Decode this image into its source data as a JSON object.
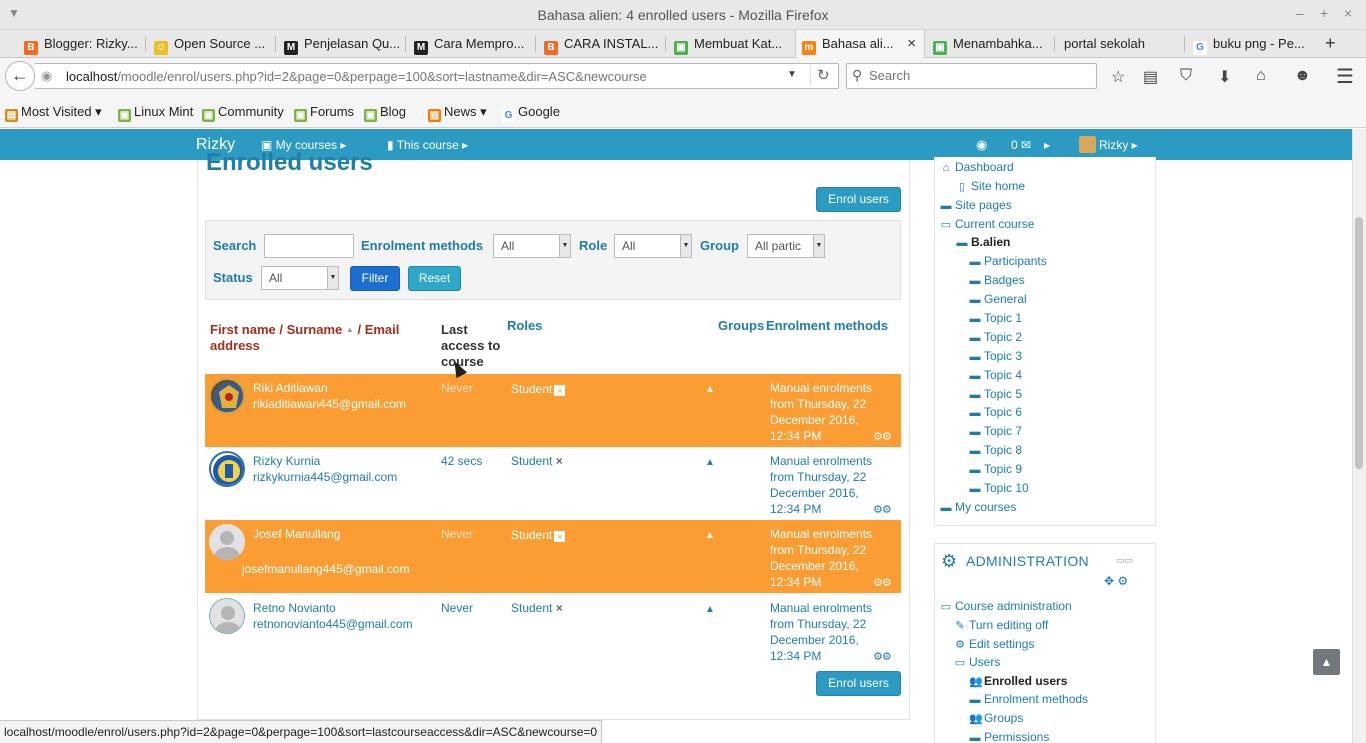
{
  "window": {
    "title": "Bahasa alien: 4 enrolled users - Mozilla Firefox",
    "menu_glyph": "▼",
    "minimize": "–",
    "maximize": "+",
    "close": "×"
  },
  "tabs": [
    {
      "label": "Blogger: Rizky...",
      "icon_color": "#f26b21",
      "icon_glyph": "B",
      "active": false
    },
    {
      "label": "Open Source ...",
      "icon_color": "#e7c02a",
      "icon_glyph": "☺",
      "active": false
    },
    {
      "label": "Penjelasan Qu...",
      "icon_color": "#222222",
      "icon_glyph": "M",
      "active": false
    },
    {
      "label": "Cara Mempro...",
      "icon_color": "#222222",
      "icon_glyph": "M",
      "active": false
    },
    {
      "label": "CARA INSTAL...",
      "icon_color": "#f26b21",
      "icon_glyph": "B",
      "active": false
    },
    {
      "label": "Membuat Kat...",
      "icon_color": "#4caf50",
      "icon_glyph": "▣",
      "active": false
    },
    {
      "label": "Bahasa ali...",
      "icon_color": "#f98012",
      "icon_glyph": "m",
      "active": true
    },
    {
      "label": "Menambahka...",
      "icon_color": "#4caf50",
      "icon_glyph": "▣",
      "active": false
    },
    {
      "label": "portal sekolah",
      "icon_color": "",
      "icon_glyph": "",
      "active": false
    },
    {
      "label": "buku png - Pe...",
      "icon_color": "#4285f4",
      "icon_glyph": "G",
      "active": false
    }
  ],
  "tab_close": "×",
  "newtab": "+",
  "nav": {
    "back": "←",
    "info": "◉",
    "url_host": "localhost",
    "url_path": "/moodle/enrol/users.php?id=2&page=0&perpage=100&sort=lastname&dir=ASC&newcourse",
    "url_drop": "▼",
    "reload": "↻",
    "search_placeholder": "Search",
    "search_icon": "🔍",
    "icons": [
      "☆",
      "▤",
      "⛉",
      "⬇",
      "⌂",
      "☻",
      "☰"
    ]
  },
  "bookmarks": [
    {
      "label": "Most Visited ▾",
      "icon": "▤",
      "color": "#d38c1c"
    },
    {
      "label": "Linux Mint",
      "icon": "▣",
      "color": "#7cb342"
    },
    {
      "label": "Community",
      "icon": "▣",
      "color": "#7cb342"
    },
    {
      "label": "Forums",
      "icon": "▣",
      "color": "#7cb342"
    },
    {
      "label": "Blog",
      "icon": "▣",
      "color": "#7cb342"
    },
    {
      "label": "News ▾",
      "icon": "▥",
      "color": "#f57c00"
    },
    {
      "label": "Google",
      "icon": "G",
      "color": "#4285f4"
    }
  ],
  "moodle_nav": {
    "brand": "Rizky",
    "my_courses": "▣ My courses ▸",
    "this_course": "▮ This course ▸",
    "info_icon": "◉",
    "messages": "0 ✉",
    "messages_arrow": "▸",
    "user": "Rizky ▸"
  },
  "page": {
    "title": "Enrolled users",
    "enrol_button": "Enrol users",
    "enrol_button_bottom": "Enrol users"
  },
  "filters": {
    "search_label": "Search",
    "search_value": "",
    "enrolment_methods_label": "Enrolment methods",
    "enrolment_methods_value": "All",
    "role_label": "Role",
    "role_value": "All",
    "group_label": "Group",
    "group_value": "All partic",
    "status_label": "Status",
    "status_value": "All",
    "filter_button": "Filter",
    "reset_button": "Reset",
    "arrow": "▼"
  },
  "table": {
    "headers": {
      "first_name": "First name",
      "sep1": "/",
      "surname": "Surname",
      "sort_arrow": "▲",
      "sep2": "/",
      "email_line1": "Email",
      "email_line2": "address",
      "last_access_1": "Last",
      "last_access_2": "access to",
      "last_access_3": "course",
      "roles": "Roles",
      "groups": "Groups",
      "enrolment_methods": "Enrolment methods"
    },
    "rows": [
      {
        "name": "Riki Aditiawan",
        "email": "rikiaditiawan445@gmail.com",
        "last_access": "Never",
        "role": "Student",
        "enrol_1": "Manual enrolments",
        "enrol_2": "from Thursday, 22",
        "enrol_3": "December 2016,",
        "enrol_4": "12:34 PM",
        "highlighted": true,
        "avatar": "emblem1"
      },
      {
        "name": "Rizky Kurnia",
        "email": "rizkykurnia445@gmail.com",
        "last_access": "42 secs",
        "role": "Student",
        "enrol_1": "Manual enrolments",
        "enrol_2": "from Thursday, 22",
        "enrol_3": "December 2016,",
        "enrol_4": "12:34 PM",
        "highlighted": false,
        "avatar": "emblem2"
      },
      {
        "name": "Josef Manullang",
        "email": "josefmanullang445@gmail.com",
        "last_access": "Never",
        "role": "Student",
        "enrol_1": "Manual enrolments",
        "enrol_2": "from Thursday, 22",
        "enrol_3": "December 2016,",
        "enrol_4": "12:34 PM",
        "highlighted": true,
        "avatar": "default"
      },
      {
        "name": "Retno Novianto",
        "email": "retnonovianto445@gmail.com",
        "last_access": "Never",
        "role": "Student",
        "enrol_1": "Manual enrolments",
        "enrol_2": "from Thursday, 22",
        "enrol_3": "December 2016,",
        "enrol_4": "12:34 PM",
        "highlighted": false,
        "avatar": "default"
      }
    ],
    "remove_glyph": "×",
    "lock_glyph": "🔒",
    "gears_glyph": "⚙⚙"
  },
  "navigation_block": {
    "items": [
      {
        "label": "Dashboard",
        "icon": "⌂",
        "bold": false
      },
      {
        "label": "Site home",
        "icon": "▯",
        "bold": false
      },
      {
        "label": "Site pages",
        "icon": "▬",
        "bold": false
      },
      {
        "label": "Current course",
        "icon": "▭",
        "bold": false
      },
      {
        "label": "B.alien",
        "icon": "▬",
        "bold": true
      },
      {
        "label": "Participants",
        "icon": "▬",
        "bold": false
      },
      {
        "label": "Badges",
        "icon": "▬",
        "bold": false
      },
      {
        "label": "General",
        "icon": "▬",
        "bold": false
      },
      {
        "label": "Topic 1",
        "icon": "▬",
        "bold": false
      },
      {
        "label": "Topic 2",
        "icon": "▬",
        "bold": false
      },
      {
        "label": "Topic 3",
        "icon": "▬",
        "bold": false
      },
      {
        "label": "Topic 4",
        "icon": "▬",
        "bold": false
      },
      {
        "label": "Topic 5",
        "icon": "▬",
        "bold": false
      },
      {
        "label": "Topic 6",
        "icon": "▬",
        "bold": false
      },
      {
        "label": "Topic 7",
        "icon": "▬",
        "bold": false
      },
      {
        "label": "Topic 8",
        "icon": "▬",
        "bold": false
      },
      {
        "label": "Topic 9",
        "icon": "▬",
        "bold": false
      },
      {
        "label": "Topic 10",
        "icon": "▬",
        "bold": false
      },
      {
        "label": "My courses",
        "icon": "▬",
        "bold": false
      }
    ]
  },
  "admin_block": {
    "title": "ADMINISTRATION",
    "icon": "⚙",
    "ctrl": "▭▭",
    "move": "✥ ⚙",
    "items": [
      {
        "label": "Course administration",
        "icon": "▭",
        "bold": false
      },
      {
        "label": "Turn editing off",
        "icon": "✎",
        "bold": false
      },
      {
        "label": "Edit settings",
        "icon": "⚙",
        "bold": false
      },
      {
        "label": "Users",
        "icon": "▭",
        "bold": false
      },
      {
        "label": "Enrolled users",
        "icon": "👥",
        "bold": true
      },
      {
        "label": "Enrolment methods",
        "icon": "▬",
        "bold": false
      },
      {
        "label": "Groups",
        "icon": "👥",
        "bold": false
      },
      {
        "label": "Permissions",
        "icon": "▬",
        "bold": false
      }
    ]
  },
  "status_url": "localhost/moodle/enrol/users.php?id=2&page=0&perpage=100&sort=lastcourseaccess&dir=ASC&newcourse=0",
  "to_top": "▲"
}
